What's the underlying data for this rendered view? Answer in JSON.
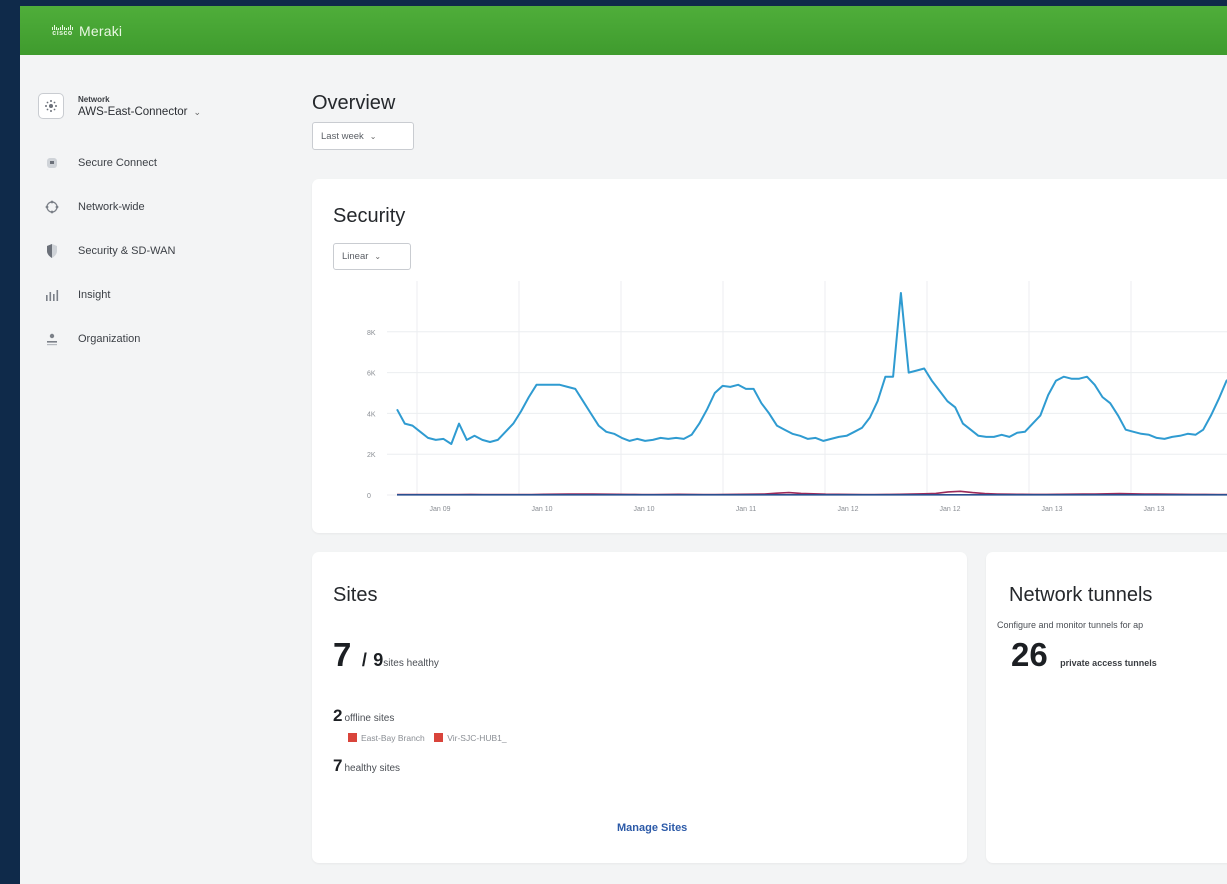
{
  "brand": {
    "cisco": "cisco",
    "product": "Meraki"
  },
  "network": {
    "label": "Network",
    "name": "AWS-East-Connector"
  },
  "sidebar": {
    "items": [
      {
        "label": "Secure Connect",
        "icon": "secure-connect-icon"
      },
      {
        "label": "Network-wide",
        "icon": "network-wide-icon"
      },
      {
        "label": "Security & SD-WAN",
        "icon": "shield-icon"
      },
      {
        "label": "Insight",
        "icon": "bar-chart-icon"
      },
      {
        "label": "Organization",
        "icon": "organization-icon"
      }
    ]
  },
  "overview": {
    "title": "Overview",
    "timeframe": "Last week"
  },
  "security": {
    "title": "Security",
    "scale": "Linear"
  },
  "chart_data": {
    "type": "line",
    "title": "Security",
    "y_ticks": [
      "0",
      "2K",
      "4K",
      "6K",
      "8K"
    ],
    "x_ticks": [
      "Jan 09",
      "Jan 10",
      "Jan 10",
      "Jan 11",
      "Jan 12",
      "Jan 12",
      "Jan 13",
      "Jan 13"
    ],
    "ylim": [
      0,
      10000
    ],
    "grid": true,
    "colors": [
      "#2f9bd1",
      "#9a2a5a",
      "#2a4f8f"
    ],
    "series": [
      {
        "values": [
          4200,
          3500,
          3400,
          3100,
          2800,
          2700,
          2750,
          2500,
          3500,
          2700,
          2900,
          2700,
          2600,
          2700,
          3100,
          3500,
          4100,
          4800,
          5400,
          5400,
          5400,
          5400,
          5300,
          5200,
          4600,
          4000,
          3400,
          3100,
          3000,
          2800,
          2650,
          2750,
          2650,
          2700,
          2800,
          2750,
          2800,
          2750,
          2950,
          3500,
          4200,
          5000,
          5350,
          5300,
          5400,
          5200,
          5200,
          4500,
          4000,
          3400,
          3200,
          3000,
          2900,
          2750,
          2800,
          2650,
          2750,
          2850,
          2900,
          3100,
          3300,
          3800,
          4600,
          5800,
          5800,
          9900,
          6000,
          6100,
          6200,
          5600,
          5100,
          4600,
          4300,
          3500,
          3200,
          2900,
          2850,
          2850,
          2950,
          2850,
          3050,
          3100,
          3500,
          3900,
          4900,
          5600,
          5800,
          5700,
          5700,
          5800,
          5400,
          4800,
          4500,
          3900,
          3200,
          3100,
          3000,
          2950,
          2800,
          2750,
          2850,
          2900,
          3000,
          2950,
          3200,
          3900,
          4700,
          5600,
          5900,
          6000
        ]
      },
      {
        "values": [
          20,
          20,
          25,
          20,
          22,
          25,
          30,
          20,
          25,
          20,
          20,
          25,
          35,
          40,
          45,
          50,
          45,
          40,
          35,
          30,
          25,
          25,
          30,
          35,
          30,
          25,
          25,
          30,
          35,
          40,
          50,
          90,
          120,
          80,
          60,
          40,
          35,
          30,
          25,
          25,
          30,
          35,
          45,
          60,
          80,
          150,
          180,
          120,
          70,
          50,
          40,
          35,
          30,
          30,
          35,
          40,
          45,
          50,
          60,
          70,
          60,
          50,
          45,
          40,
          35,
          30,
          30,
          25,
          25,
          30
        ]
      },
      {
        "values": [
          10,
          10,
          10,
          10,
          10,
          10,
          10,
          10,
          10,
          10,
          10,
          10,
          10,
          10,
          10,
          10,
          10,
          10,
          10,
          10
        ]
      }
    ]
  },
  "sites": {
    "title": "Sites",
    "healthy_count": "7",
    "separator": "/",
    "total_count": "9",
    "healthy_suffix": "sites healthy",
    "offline_count": "2",
    "offline_label": "offline sites",
    "offline_sites": [
      "East-Bay Branch",
      "Vir-SJC-HUB1_"
    ],
    "healthy_sites_count": "7",
    "healthy_sites_label": "healthy sites",
    "manage_label": "Manage Sites"
  },
  "tunnels": {
    "title": "Network tunnels",
    "description": "Configure and monitor tunnels for ap",
    "count": "26",
    "count_label": "private access tunnels"
  }
}
